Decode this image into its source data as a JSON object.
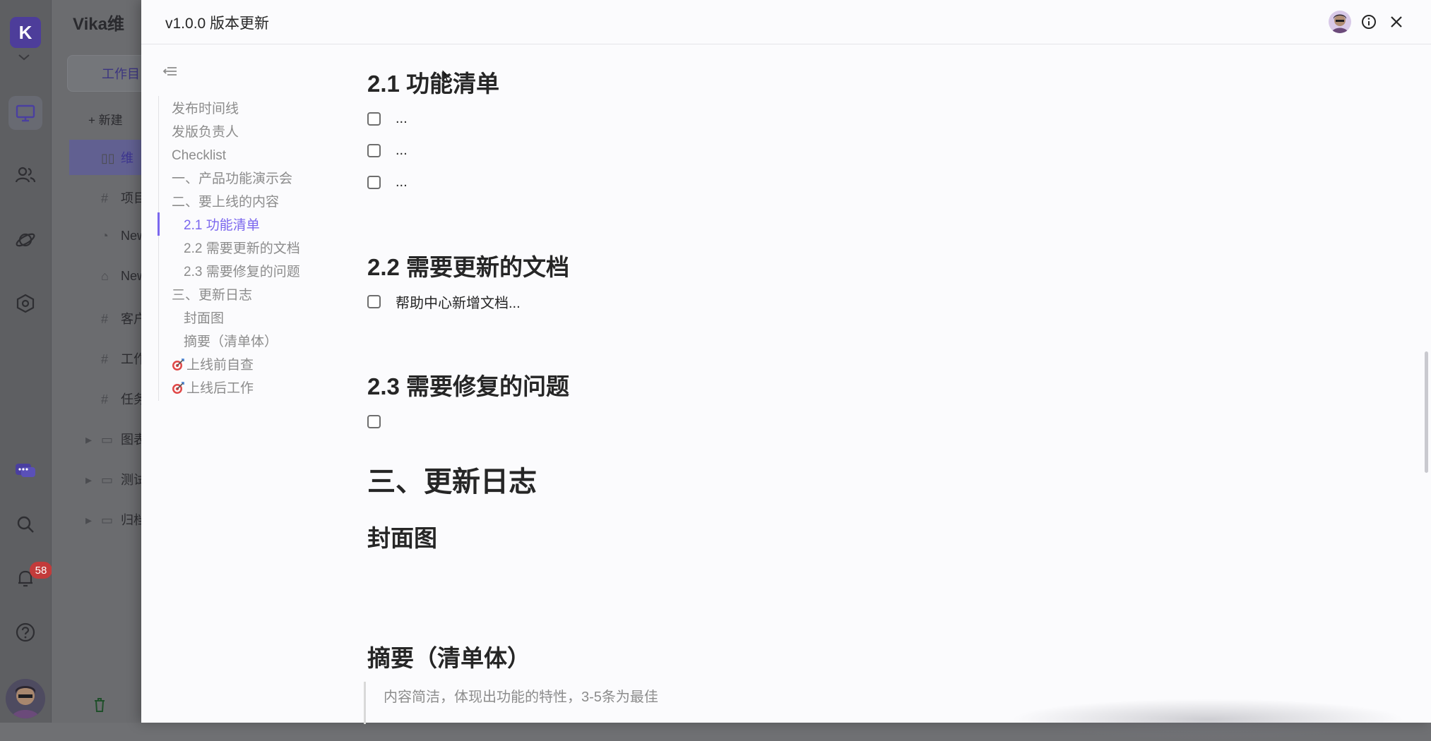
{
  "app": {
    "workspace_title": "Vika维",
    "tab_label": "工作目",
    "new_label": "+ 新建",
    "sidebar_items": [
      {
        "icon": "book-icon",
        "label": "维"
      },
      {
        "icon": "hash-icon",
        "label": "项目"
      },
      {
        "icon": "gauge-icon",
        "label": "New"
      },
      {
        "icon": "robot-icon",
        "label": "New"
      },
      {
        "icon": "hash-icon",
        "label": "客户"
      },
      {
        "icon": "hash-icon",
        "label": "工作"
      },
      {
        "icon": "hash-icon",
        "label": "任务"
      },
      {
        "icon": "folder-icon",
        "label": "图表"
      },
      {
        "icon": "folder-icon",
        "label": "测试"
      },
      {
        "icon": "folder-icon",
        "label": "归档"
      }
    ],
    "notification_count": "58"
  },
  "modal": {
    "title": "v1.0.0 版本更新"
  },
  "outline": {
    "items": [
      {
        "label": "发布时间线",
        "level": 1
      },
      {
        "label": "发版负责人",
        "level": 1
      },
      {
        "label": "Checklist",
        "level": 1
      },
      {
        "label": "一、产品功能演示会",
        "level": 1
      },
      {
        "label": "二、要上线的内容",
        "level": 1
      },
      {
        "label": "2.1 功能清单",
        "level": 2,
        "active": true
      },
      {
        "label": "2.2 需要更新的文档",
        "level": 2
      },
      {
        "label": "2.3 需要修复的问题",
        "level": 2
      },
      {
        "label": "三、更新日志",
        "level": 1
      },
      {
        "label": "封面图",
        "level": 2
      },
      {
        "label": "摘要（清单体）",
        "level": 2
      },
      {
        "label": "上线前自查",
        "level": 1,
        "icon": "dart-icon"
      },
      {
        "label": "上线后工作",
        "level": 1,
        "icon": "dart-icon"
      }
    ]
  },
  "doc": {
    "section_21": {
      "heading": "2.1 功能清单",
      "todos": [
        "...",
        "...",
        "..."
      ]
    },
    "section_22": {
      "heading": "2.2 需要更新的文档",
      "todos": [
        "帮助中心新增文档..."
      ]
    },
    "section_23": {
      "heading": "2.3 需要修复的问题",
      "todos": [
        ""
      ]
    },
    "section_3": {
      "heading": "三、更新日志"
    },
    "cover": {
      "heading": "封面图"
    },
    "summary": {
      "heading": "摘要（清单体）",
      "quote": "内容简洁，体现出功能的特性，3-5条为最佳"
    }
  },
  "colors": {
    "accent": "#7b67ee",
    "overlay": "#6f7073",
    "modal_bg": "#fbfbfd",
    "badge": "#c23b3b"
  }
}
